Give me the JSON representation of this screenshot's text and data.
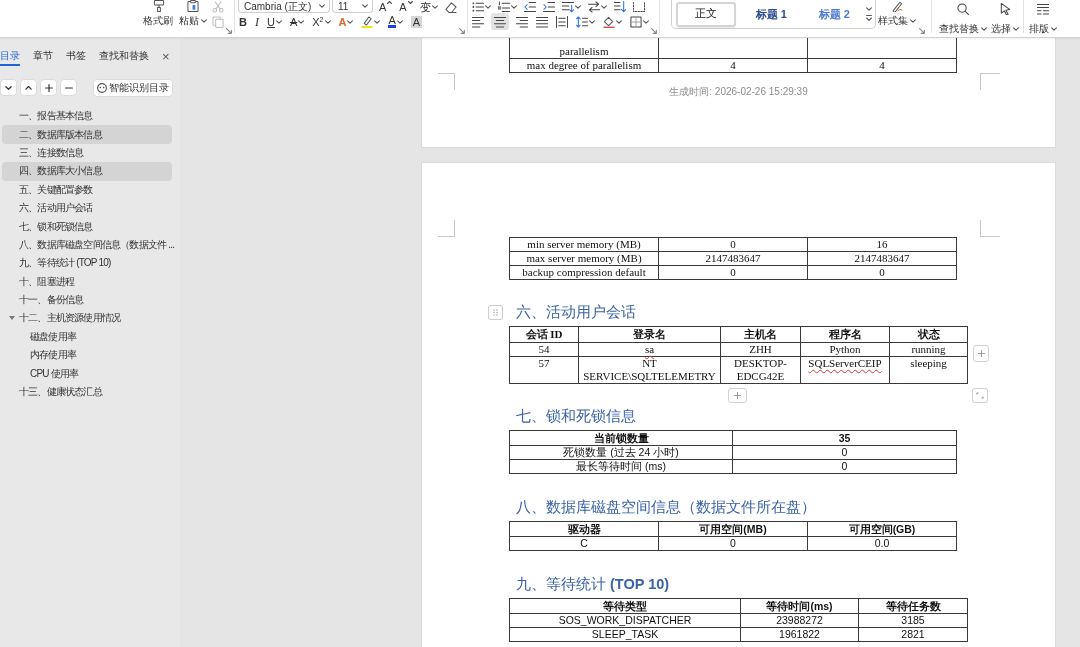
{
  "ribbon": {
    "clipboard": [
      {
        "kind": "format-painter",
        "label": "格式刷"
      },
      {
        "kind": "paste",
        "label": "粘贴",
        "dropdown": true
      },
      {
        "kind": "cut",
        "disabled": true
      },
      {
        "kind": "copy",
        "disabled": true
      }
    ],
    "font": {
      "name": "Cambria (正文)",
      "size": "11",
      "row1": [
        {
          "kind": "grow",
          "label": "A"
        },
        {
          "kind": "shrink",
          "label": "A"
        },
        {
          "kind": "phonetic",
          "label": "变",
          "dropdown": true
        },
        {
          "kind": "clear"
        }
      ],
      "row2": [
        {
          "kind": "bold",
          "label": "B"
        },
        {
          "kind": "italic",
          "label": "I"
        },
        {
          "kind": "underline",
          "label": "U",
          "dropdown": true
        },
        {
          "kind": "strike",
          "label": "A",
          "dropdown": true
        },
        {
          "kind": "superscript",
          "label": "X$^{2}$",
          "dropdown": true
        },
        {
          "kind": "effect",
          "label": "A",
          "dropdown": true
        },
        {
          "kind": "highlight",
          "dropdown": true
        },
        {
          "kind": "color",
          "label": "A",
          "dropdown": true
        },
        {
          "kind": "shade",
          "label": "A"
        }
      ]
    },
    "paragraph": {
      "row1": [
        {
          "kind": "bullets",
          "dropdown": true
        },
        {
          "kind": "numbering",
          "dropdown": true
        },
        {
          "kind": "outdent"
        },
        {
          "kind": "indent"
        },
        {
          "kind": "asian-layout",
          "dropdown": true
        },
        {
          "kind": "direction",
          "dropdown": true
        },
        {
          "kind": "sort"
        },
        {
          "kind": "marks"
        }
      ],
      "row2": [
        {
          "kind": "align-left",
          "selected": false
        },
        {
          "kind": "align-center",
          "selected": true
        },
        {
          "kind": "align-right",
          "selected": false
        },
        {
          "kind": "justify",
          "selected": false
        },
        {
          "kind": "distribute",
          "selected": false
        },
        {
          "kind": "line-spacing",
          "dropdown": true
        },
        {
          "kind": "shading",
          "dropdown": true
        },
        {
          "kind": "border",
          "dropdown": true
        }
      ]
    },
    "styles": [
      {
        "kind": "body",
        "label": "正文",
        "selected": true
      },
      {
        "kind": "heading1",
        "label": "标题 1",
        "selected": false
      },
      {
        "kind": "heading2",
        "label": "标题 2",
        "selected": false
      }
    ],
    "commands": [
      {
        "kind": "style-set",
        "label": "样式集",
        "dropdown": true
      },
      {
        "kind": "find",
        "label": "查找替换",
        "dropdown": true
      },
      {
        "kind": "select",
        "label": "选择",
        "dropdown": true
      },
      {
        "kind": "layout",
        "label": "排版",
        "dropdown": true
      }
    ]
  },
  "sidebar": {
    "tabs": [
      {
        "label": "目录",
        "selected": true
      },
      {
        "label": "章节",
        "selected": false
      },
      {
        "label": "书签",
        "selected": false
      },
      {
        "label": "查找和替换",
        "selected": false
      }
    ],
    "close": "×",
    "smart_button": "智能识别目录",
    "toc": [
      {
        "label": "一、报告基本信息",
        "selected": false
      },
      {
        "label": "二、数据库版本信息",
        "selected": true
      },
      {
        "label": "三、连接数信息",
        "selected": false
      },
      {
        "label": "四、数据库大小信息",
        "selected": true
      },
      {
        "label": "五、关键配置参数",
        "selected": false
      },
      {
        "label": "六、活动用户会话",
        "selected": false
      },
      {
        "label": "七、锁和死锁信息",
        "selected": false
      },
      {
        "label": "八、数据库磁盘空间信息（数据文件 ...",
        "selected": false
      },
      {
        "label": "九、等待统计 (TOP 10)",
        "selected": false
      },
      {
        "label": "十、阻塞进程",
        "selected": false
      },
      {
        "label": "十一、备份信息",
        "selected": false
      },
      {
        "label": "十二、主机资源使用情况",
        "selected": false,
        "expanded": true,
        "children": [
          {
            "label": "磁盘使用率",
            "selected": false
          },
          {
            "label": "内存使用率",
            "selected": false
          },
          {
            "label": "CPU 使用率",
            "selected": false
          }
        ]
      },
      {
        "label": "十三、健康状态汇总",
        "selected": false
      }
    ]
  },
  "document": {
    "pages": [
      {
        "continued_table": {
          "rows": [
            [
              "parallelism"
            ],
            [
              "max degree of parallelism",
              "4",
              "4"
            ]
          ]
        },
        "footer": "生成时间: 2026-02-26 15:29:39"
      },
      {
        "continued_table": {
          "rows": [
            [
              "min server memory (MB)",
              "0",
              "16"
            ],
            [
              "max server memory (MB)",
              "2147483647",
              "2147483647"
            ],
            [
              "backup compression default",
              "0",
              "0"
            ]
          ]
        },
        "sections": [
          {
            "heading": "六、活动用户会话",
            "table": {
              "active": true,
              "columns": [
                "会话 ID",
                "登录名",
                "主机名",
                "程序名",
                "状态"
              ],
              "rows": [
                [
                  "54",
                  {
                    "text": "sa",
                    "spelling_error": true
                  },
                  "ZHH",
                  "Python",
                  "running"
                ],
                [
                  "57",
                  "NT SERVICE\\SQLTELEMETRY",
                  "DESKTOP-EDCG42E",
                  {
                    "text": "SQLServerCEIP",
                    "spelling_error": true
                  },
                  "sleeping"
                ]
              ]
            }
          },
          {
            "heading": "七、锁和死锁信息",
            "table": {
              "active": false,
              "columns": [
                "当前锁数量",
                "35"
              ],
              "rows": [
                [
                  "死锁数量 (过去 24 小时)",
                  "0"
                ],
                [
                  "最长等待时间 (ms)",
                  "0"
                ]
              ]
            }
          },
          {
            "heading": "八、数据库磁盘空间信息（数据文件所在盘）",
            "table": {
              "active": false,
              "columns": [
                "驱动器",
                "可用空间(MB)",
                "可用空间(GB)"
              ],
              "rows": [
                [
                  "C",
                  "0",
                  "0.0"
                ]
              ]
            }
          },
          {
            "heading": "九、等待统计 **(TOP 10)**",
            "table": {
              "active": false,
              "columns": [
                "等待类型",
                "等待时间(ms)",
                "等待任务数"
              ],
              "rows": [
                [
                  "SOS_WORK_DISPATCHER",
                  "23988272",
                  "3185"
                ],
                [
                  "SLEEP_TASK",
                  "1961822",
                  "2821"
                ]
              ]
            }
          }
        ]
      }
    ]
  }
}
